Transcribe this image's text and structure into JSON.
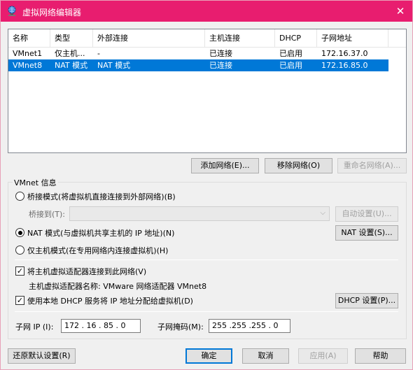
{
  "window": {
    "title": "虚拟网络编辑器",
    "close_glyph": "✕",
    "titlebar_color": "#e81d6f"
  },
  "table": {
    "headers": [
      "名称",
      "类型",
      "外部连接",
      "主机连接",
      "DHCP",
      "子网地址"
    ],
    "rows": [
      [
        "VMnet1",
        "仅主机...",
        "-",
        "已连接",
        "已启用",
        "172.16.37.0"
      ],
      [
        "VMnet8",
        "NAT 模式",
        "NAT 模式",
        "已连接",
        "已启用",
        "172.16.85.0"
      ]
    ],
    "selected_row": 1
  },
  "table_buttons": {
    "add": "添加网络(E)...",
    "remove": "移除网络(O)",
    "rename": "重命名网络(A)..."
  },
  "vmnet_info": {
    "title": "VMnet 信息",
    "bridged_label": "桥接模式(将虚拟机直接连接到外部网络)(B)",
    "bridged_to_label": "桥接到(T):",
    "bridged_to_value": "",
    "auto_settings": "自动设置(U)...",
    "nat_label": "NAT 模式(与虚拟机共享主机的 IP 地址)(N)",
    "nat_settings": "NAT 设置(S)...",
    "hostonly_label": "仅主机模式(在专用网络内连接虚拟机)(H)",
    "selected_mode": "nat",
    "connect_adapter_label": "将主机虚拟适配器连接到此网络(V)",
    "connect_adapter_checked": true,
    "adapter_name_label": "主机虚拟适配器名称: VMware 网络适配器 VMnet8",
    "use_dhcp_label": "使用本地 DHCP 服务将 IP 地址分配给虚拟机(D)",
    "use_dhcp_checked": true,
    "dhcp_settings": "DHCP 设置(P)...",
    "subnet_ip_label": "子网 IP (I):",
    "subnet_ip_value": "172 . 16 . 85 . 0",
    "subnet_mask_label": "子网掩码(M):",
    "subnet_mask_value": "255 .255 .255 . 0"
  },
  "footer": {
    "restore": "还原默认设置(R)",
    "ok": "确定",
    "cancel": "取消",
    "apply": "应用(A)",
    "help": "帮助"
  },
  "check_glyph": "✓"
}
